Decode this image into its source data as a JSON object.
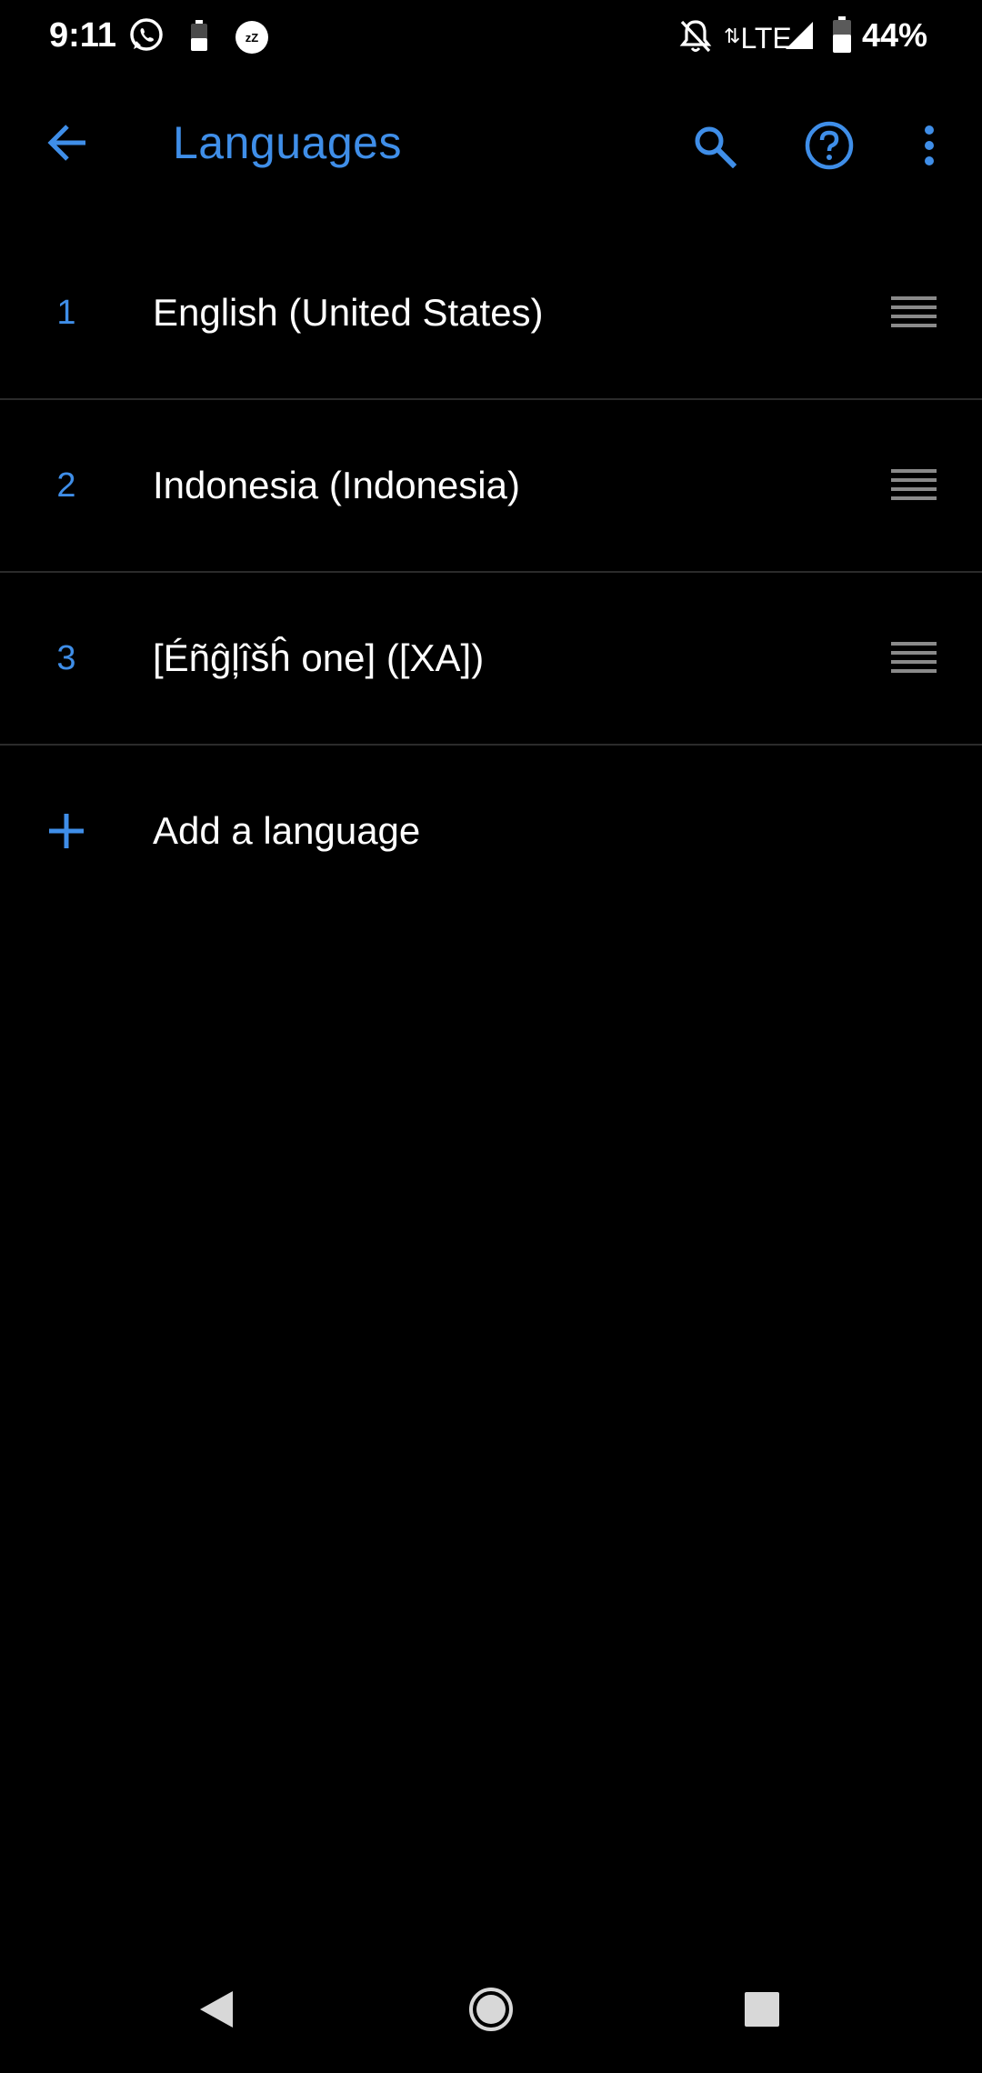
{
  "status_bar": {
    "time": "9:11",
    "network": "LTE",
    "battery_percent": "44%",
    "icons": [
      "whatsapp-icon",
      "battery-small-icon",
      "zz-icon",
      "bell-off-icon",
      "data-arrows-icon",
      "signal-icon",
      "battery-icon"
    ]
  },
  "app_bar": {
    "title": "Languages",
    "icons": [
      "back-arrow-icon",
      "search-icon",
      "help-icon",
      "more-vert-icon"
    ]
  },
  "languages": [
    {
      "index": "1",
      "label": "English (United States)"
    },
    {
      "index": "2",
      "label": "Indonesia (Indonesia)"
    },
    {
      "index": "3",
      "label": "[Éñĝļîšĥ one] ([XA])"
    }
  ],
  "add_language": {
    "label": "Add a language",
    "icon": "plus-icon"
  },
  "nav_bar": {
    "icons": [
      "nav-back-icon",
      "nav-home-icon",
      "nav-recents-icon"
    ]
  },
  "colors": {
    "background": "#000000",
    "accent": "#3f8ee8",
    "text": "#ffffff",
    "divider": "#2b2b2b",
    "handle": "#8a8a8a"
  }
}
